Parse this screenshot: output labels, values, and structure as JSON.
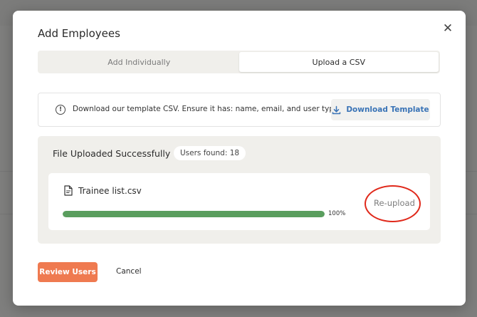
{
  "modal": {
    "title": "Add Employees",
    "close_icon": "close-icon"
  },
  "tabs": [
    {
      "label": "Add Individually",
      "active": false
    },
    {
      "label": "Upload a CSV",
      "active": true
    }
  ],
  "info": {
    "icon": "info-icon",
    "text": "Download our template CSV. Ensure it has: name, email, and user type.",
    "download_button": {
      "label": "Download Template",
      "icon": "download-icon"
    }
  },
  "upload": {
    "title": "File Uploaded Successfully",
    "users_found": "Users found: 18",
    "file": {
      "icon": "document-icon",
      "name": "Trainee list.csv",
      "progress": 1.0,
      "progress_label": "100%",
      "reupload_label": "Re-upload"
    }
  },
  "actions": {
    "review_label": "Review Users",
    "cancel_label": "Cancel"
  },
  "colors": {
    "accent": "#ef7a50",
    "link": "#3973b6",
    "progress": "#5a9e5e",
    "highlight": "#e0291b"
  }
}
